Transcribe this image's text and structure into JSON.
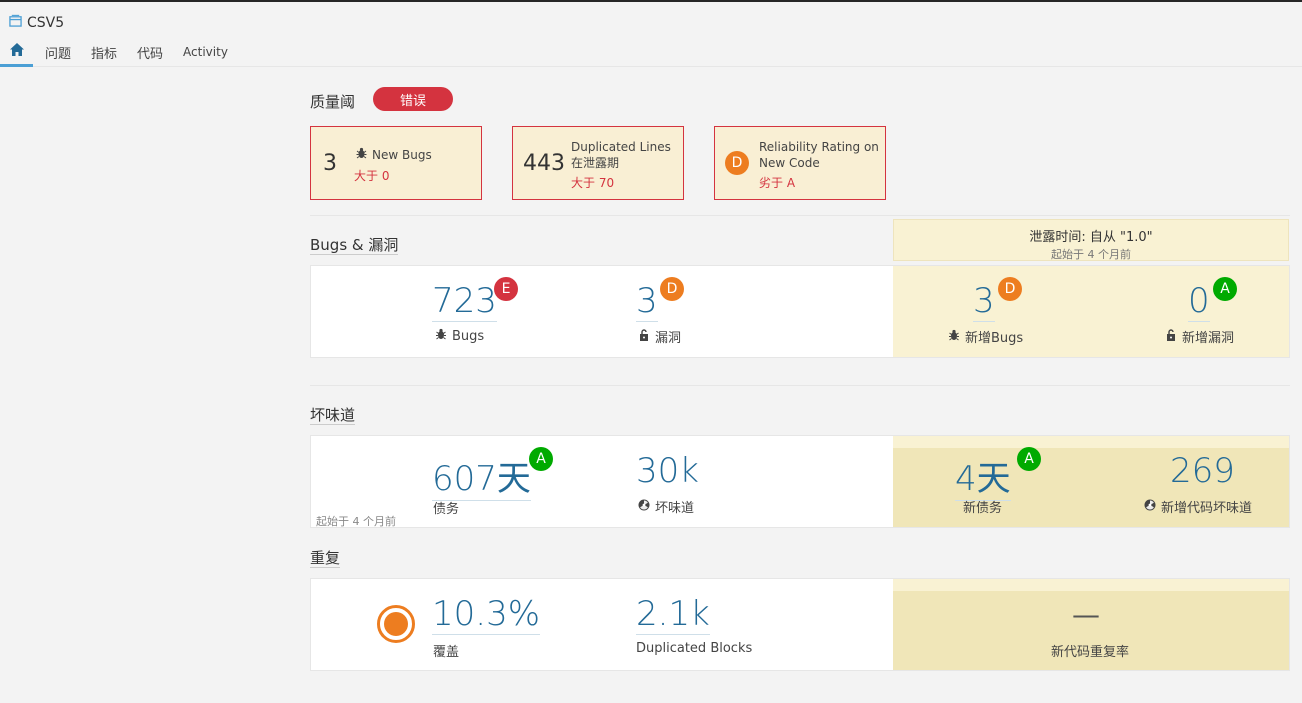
{
  "project": {
    "name": "CSV5"
  },
  "nav": {
    "issues": "问题",
    "measures": "指标",
    "code": "代码",
    "activity": "Activity"
  },
  "quality_gate": {
    "title": "质量阈",
    "status": "错误",
    "conditions": [
      {
        "value": "3",
        "label": "New Bugs",
        "label2": "",
        "error": "大于 0"
      },
      {
        "value": "443",
        "label": "Duplicated Lines",
        "label2": "在泄露期",
        "error": "大于 70"
      },
      {
        "rating": "D",
        "label": "Reliability Rating on",
        "label2": "New Code",
        "error": "劣于 A"
      }
    ]
  },
  "leak": {
    "title": "泄露时间: 自从 \"1.0\"",
    "since": "起始于 4 个月前"
  },
  "bugs_section": {
    "title": "Bugs & 漏洞",
    "bugs": {
      "value": "723",
      "rating": "E",
      "label": "Bugs"
    },
    "vulns": {
      "value": "3",
      "rating": "D",
      "label": "漏洞"
    },
    "new_bugs": {
      "value": "3",
      "rating": "D",
      "label": "新增Bugs"
    },
    "new_vulns": {
      "value": "0",
      "rating": "A",
      "label": "新增漏洞"
    }
  },
  "smells_section": {
    "title": "坏味道",
    "debt": {
      "value": "607天",
      "rating": "A",
      "label": "债务"
    },
    "smells": {
      "value": "30k",
      "label": "坏味道"
    },
    "since": "起始于 4 个月前",
    "new_debt": {
      "value": "4天",
      "rating": "A",
      "label": "新债务"
    },
    "new_smells": {
      "value": "269",
      "label": "新增代码坏味道"
    }
  },
  "dup_section": {
    "title": "重复",
    "coverage": {
      "value": "10.3%",
      "label": "覆盖"
    },
    "blocks": {
      "value": "2.1k",
      "label": "Duplicated Blocks"
    },
    "new_dup": {
      "value": "—",
      "label": "新代码重复率"
    }
  },
  "colors": {
    "error": "#d4333f",
    "rating_D": "#ed7d20",
    "rating_A": "#00aa00",
    "link": "#236a97",
    "leak_bg": "#f9f2d3"
  },
  "icons": [
    "project-icon",
    "home-icon",
    "bug-icon",
    "lock-icon",
    "smell-icon",
    "coverage-donut-icon"
  ]
}
